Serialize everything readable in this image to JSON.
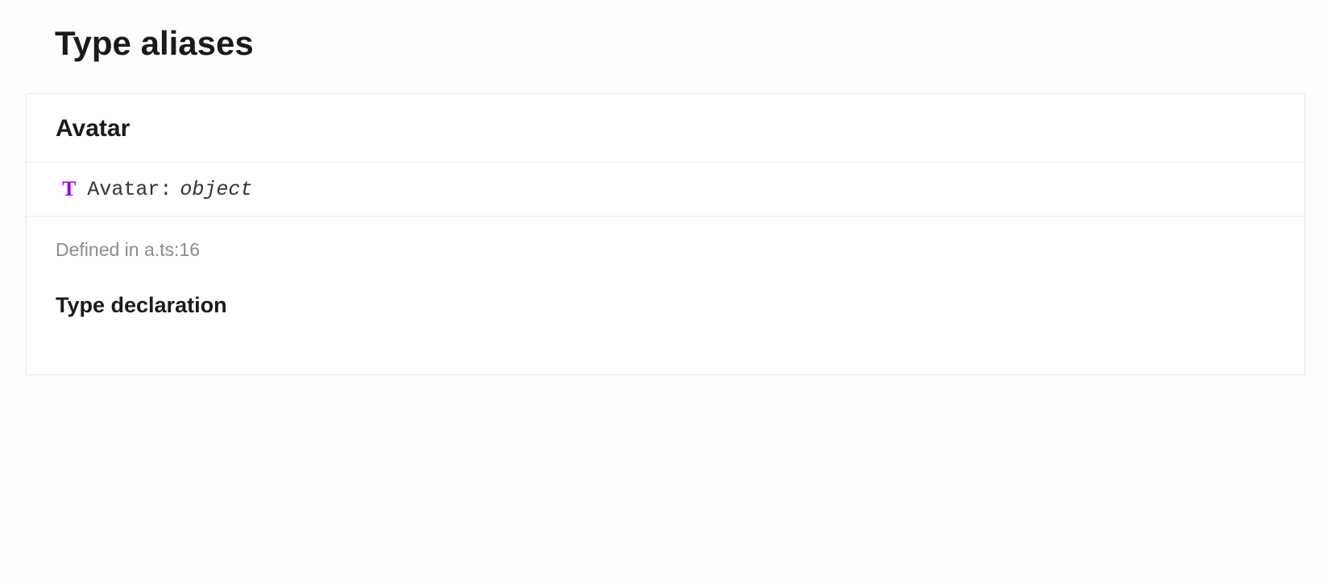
{
  "section": {
    "title": "Type aliases"
  },
  "typeAlias": {
    "name": "Avatar",
    "iconGlyph": "T",
    "signature": {
      "name": "Avatar",
      "colon": ":",
      "type": "object"
    },
    "definedIn": "Defined in a.ts:16",
    "declarationHeading": "Type declaration"
  }
}
